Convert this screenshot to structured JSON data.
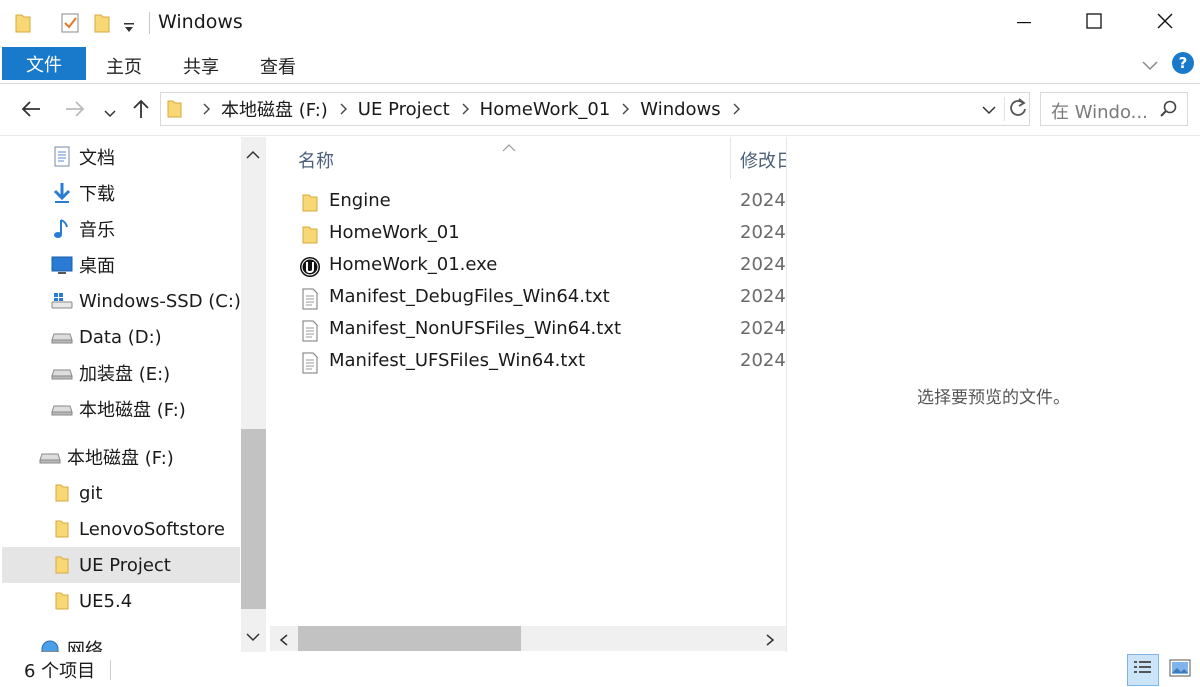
{
  "window": {
    "title": "Windows",
    "minimize_icon": "minimize-icon",
    "maximize_icon": "maximize-icon",
    "close_icon": "close-icon"
  },
  "ribbon": {
    "tabs": [
      {
        "label": "文件"
      },
      {
        "label": "主页"
      },
      {
        "label": "共享"
      },
      {
        "label": "查看"
      }
    ],
    "help_label": "?"
  },
  "address": {
    "breadcrumbs": [
      "本地磁盘 (F:)",
      "UE Project",
      "HomeWork_01",
      "Windows"
    ]
  },
  "search": {
    "placeholder": "在 Windo..."
  },
  "navpane": {
    "items": [
      {
        "label": "文档",
        "icon": "document-icon"
      },
      {
        "label": "下载",
        "icon": "download-icon"
      },
      {
        "label": "音乐",
        "icon": "music-icon"
      },
      {
        "label": "桌面",
        "icon": "desktop-icon"
      },
      {
        "label": "Windows-SSD (C:)",
        "icon": "windows-drive-icon"
      },
      {
        "label": "Data (D:)",
        "icon": "drive-icon"
      },
      {
        "label": "加装盘 (E:)",
        "icon": "drive-icon"
      },
      {
        "label": "本地磁盘 (F:)",
        "icon": "drive-icon"
      },
      {
        "label": "本地磁盘 (F:)",
        "icon": "drive-icon"
      },
      {
        "label": "git",
        "icon": "folder-icon"
      },
      {
        "label": "LenovoSoftstore",
        "icon": "folder-icon"
      },
      {
        "label": "UE Project",
        "icon": "folder-icon",
        "selected": true
      },
      {
        "label": "UE5.4",
        "icon": "folder-icon"
      },
      {
        "label": "网络",
        "icon": "network-icon"
      }
    ]
  },
  "filelist": {
    "columns": {
      "name": "名称",
      "date": "修改日"
    },
    "files": [
      {
        "name": "Engine",
        "date": "2024",
        "icon": "folder-icon"
      },
      {
        "name": "HomeWork_01",
        "date": "2024",
        "icon": "folder-icon"
      },
      {
        "name": "HomeWork_01.exe",
        "date": "2024",
        "icon": "unreal-engine-icon"
      },
      {
        "name": "Manifest_DebugFiles_Win64.txt",
        "date": "2024",
        "icon": "text-file-icon"
      },
      {
        "name": "Manifest_NonUFSFiles_Win64.txt",
        "date": "2024",
        "icon": "text-file-icon"
      },
      {
        "name": "Manifest_UFSFiles_Win64.txt",
        "date": "2024",
        "icon": "text-file-icon"
      }
    ]
  },
  "preview": {
    "message": "选择要预览的文件。"
  },
  "status": {
    "item_count": "6 个项目"
  },
  "colors": {
    "accent": "#1979ca",
    "folder": "#f8d775",
    "selection": "#e5e5e5"
  }
}
